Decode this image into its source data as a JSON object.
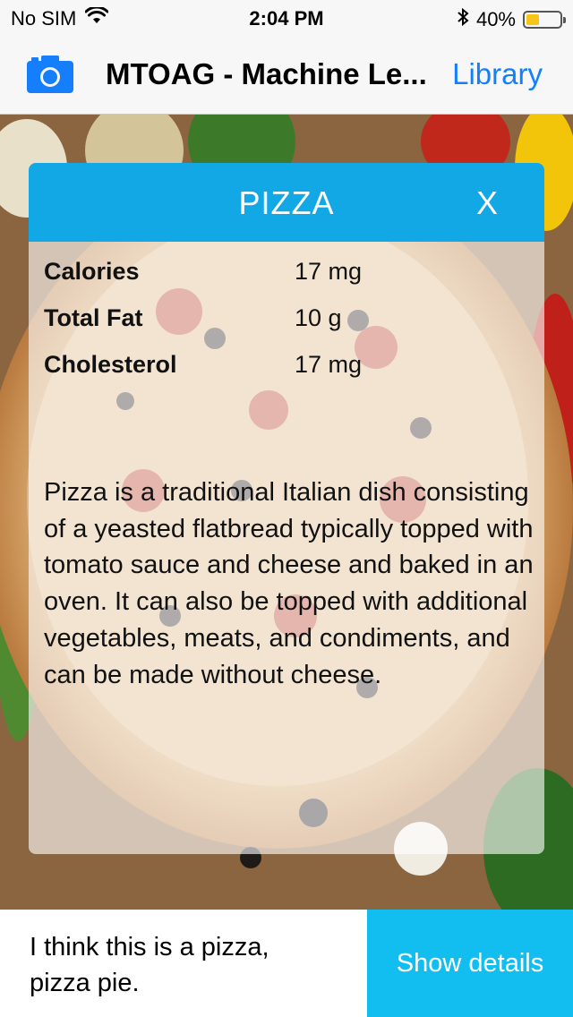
{
  "status": {
    "carrier": "No SIM",
    "time": "2:04 PM",
    "battery_text": "40%",
    "battery_level": 0.4,
    "icons": [
      "wifi-icon",
      "bluetooth-icon",
      "battery-icon"
    ]
  },
  "nav": {
    "title": "MTOAG - Machine Le...",
    "right_button": "Library",
    "left_icon": "camera-icon",
    "accent_color": "#147efb"
  },
  "card": {
    "title": "PIZZA",
    "close_label": "X",
    "header_color": "#12a8e6",
    "nutrition": [
      {
        "label": "Calories",
        "value": "17 mg"
      },
      {
        "label": "Total Fat",
        "value": "10 g"
      },
      {
        "label": "Cholesterol",
        "value": "17 mg"
      }
    ],
    "description": "Pizza is a traditional Italian dish consisting of a yeasted flatbread typically topped with tomato sauce and cheese and baked in an oven. It can also be topped with additional vegetables, meats, and condiments, and can be made without cheese."
  },
  "bottom": {
    "prediction_text": "I think this is a pizza, pizza pie.",
    "details_button": "Show details",
    "button_color": "#12bdf0"
  }
}
